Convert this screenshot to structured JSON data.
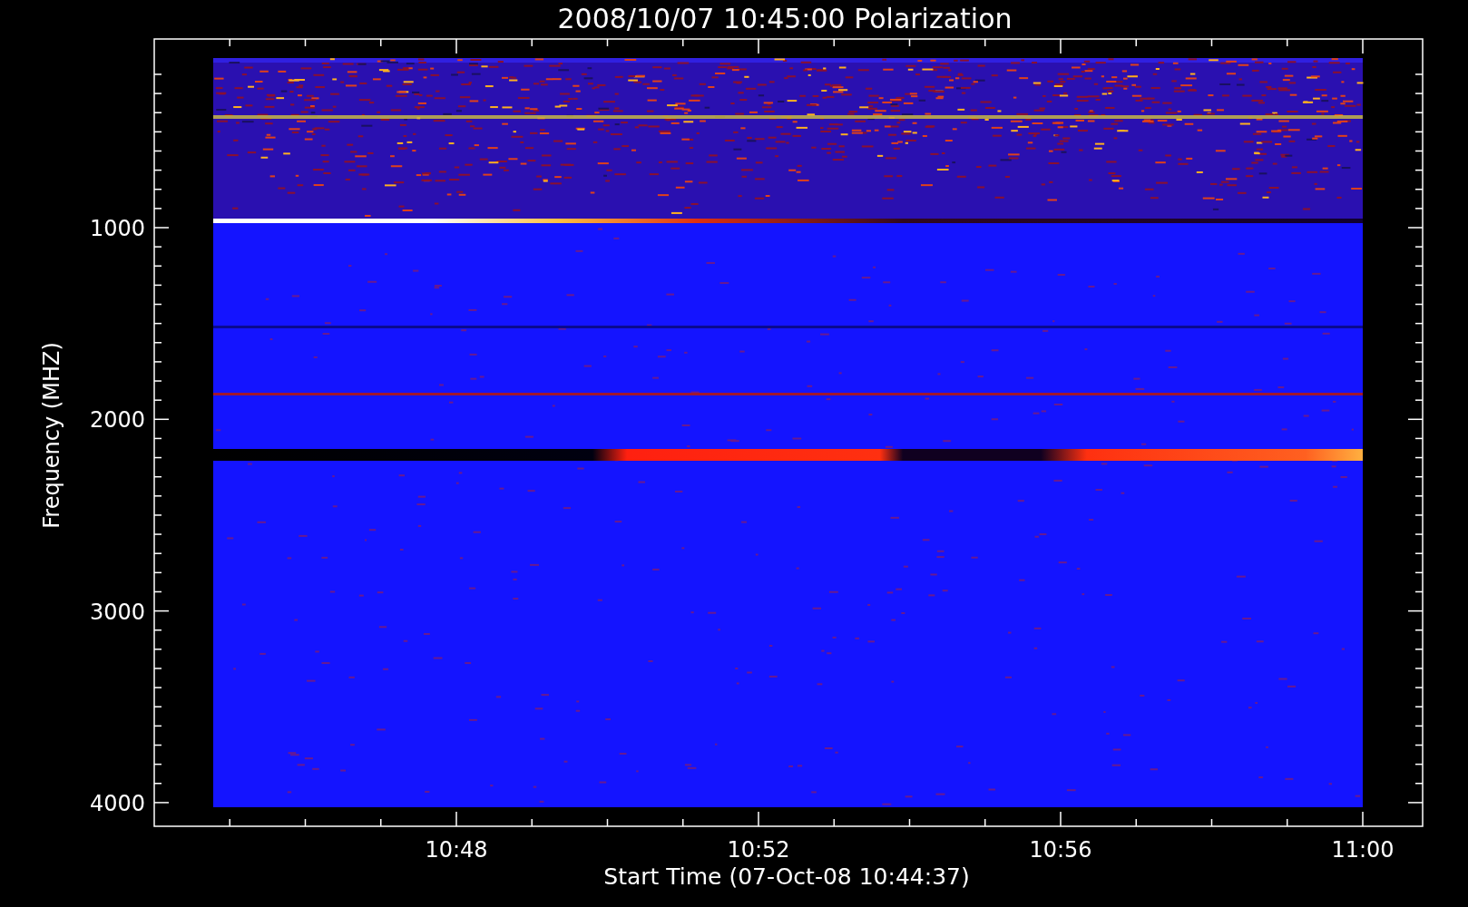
{
  "title": "2008/10/07 10:45:00 Polarization",
  "y_axis": {
    "label": "Frequency (MHZ)",
    "ticks": [
      "1000",
      "2000",
      "3000",
      "4000"
    ]
  },
  "x_axis": {
    "label": "Start Time (07-Oct-08 10:44:37)",
    "ticks": [
      "10:48",
      "10:52",
      "10:56",
      "11:00"
    ]
  }
}
